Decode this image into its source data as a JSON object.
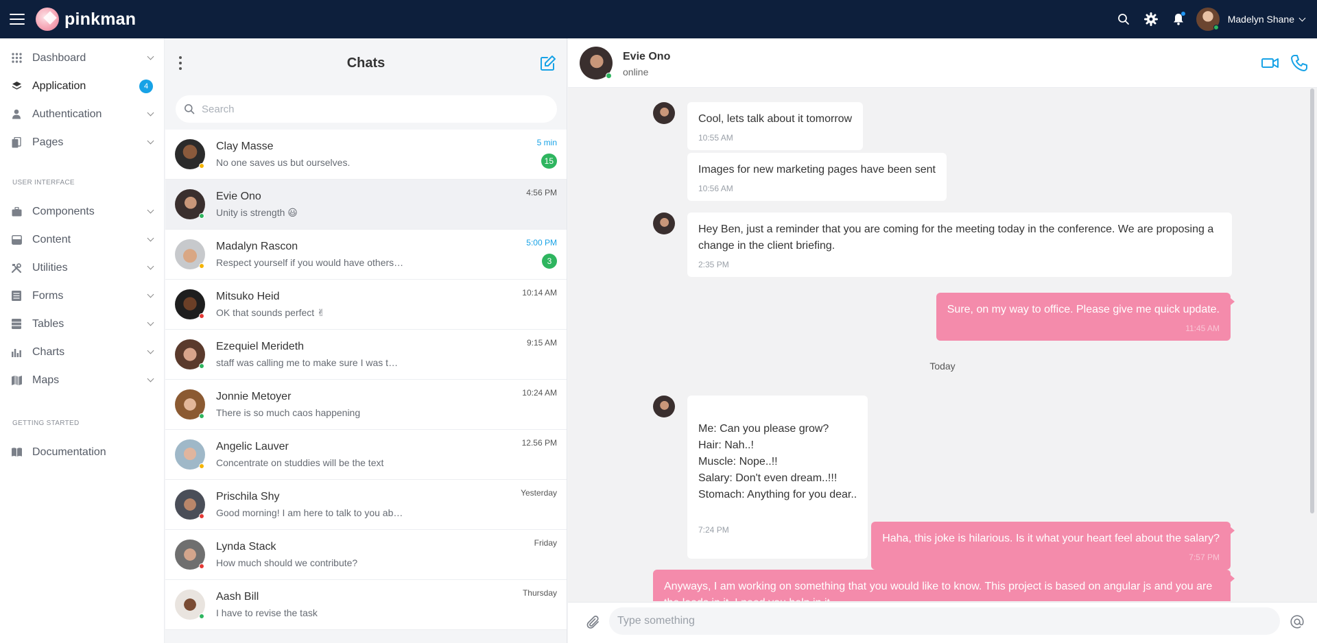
{
  "app": {
    "name": "pinkman",
    "user_name": "Madelyn Shane"
  },
  "sidebar": {
    "items": [
      {
        "label": "Dashboard"
      },
      {
        "label": "Application",
        "badge": "4"
      },
      {
        "label": "Authentication"
      },
      {
        "label": "Pages"
      }
    ],
    "section_ui": "USER INTERFACE",
    "ui_items": [
      {
        "label": "Components"
      },
      {
        "label": "Content"
      },
      {
        "label": "Utilities"
      },
      {
        "label": "Forms"
      },
      {
        "label": "Tables"
      },
      {
        "label": "Charts"
      },
      {
        "label": "Maps"
      }
    ],
    "section_start": "GETTING STARTED",
    "start_items": [
      {
        "label": "Documentation"
      }
    ]
  },
  "chatlist": {
    "title": "Chats",
    "search_placeholder": "Search",
    "conversations": [
      {
        "name": "Clay Masse",
        "message": "No one saves us but ourselves.",
        "time": "5 min",
        "unread": "15"
      },
      {
        "name": "Evie Ono",
        "message": "Unity is strength 😃",
        "time": "4:56 PM"
      },
      {
        "name": "Madalyn Rascon",
        "message": "Respect yourself if you would have others…",
        "time": "5:00 PM",
        "unread": "3"
      },
      {
        "name": "Mitsuko Heid",
        "message": "OK that sounds perfect ✌",
        "time": "10:14 AM"
      },
      {
        "name": "Ezequiel Merideth",
        "message": "staff was calling me to make sure I was t…",
        "time": "9:15 AM"
      },
      {
        "name": "Jonnie Metoyer",
        "message": "There is so much caos happening",
        "time": "10:24 AM"
      },
      {
        "name": "Angelic Lauver",
        "message": "Concentrate on studdies will be the text",
        "time": "12.56 PM"
      },
      {
        "name": "Prischila Shy",
        "message": "Good morning! I am here to talk to you ab…",
        "time": "Yesterday"
      },
      {
        "name": "Lynda Stack",
        "message": "How much should we contribute?",
        "time": "Friday"
      },
      {
        "name": "Aash Bill",
        "message": "I have to revise the task",
        "time": "Thursday"
      }
    ]
  },
  "chat": {
    "contact_name": "Evie Ono",
    "contact_status": "online",
    "messages": [
      {
        "text": "Cool, lets talk about it tomorrow",
        "time": "10:55 AM"
      },
      {
        "text": "Images for new marketing pages have been sent",
        "time": "10:56 AM"
      },
      {
        "text": "Hey Ben, just a reminder that you are coming for the meeting today in the conference. We are proposing a change in the client briefing.",
        "time": "2:35 PM"
      },
      {
        "text": "Sure, on my way to office. Please give me quick update.",
        "time": "11:45 AM"
      },
      {
        "text": "Me: Can you please grow?\nHair: Nah..!\nMuscle: Nope..!!\nSalary: Don't even dream..!!!\nStomach: Anything for you dear..",
        "time": "7:24 PM"
      },
      {
        "text": "Haha, this joke is hilarious. Is it what your heart feel about the salary?",
        "time": "7:57 PM"
      },
      {
        "text": "Anyways, I am working on something that you would like to know. This project is based on angular js and you are the leads in it. I need you help in it"
      }
    ],
    "day_separator": "Today",
    "input_placeholder": "Type something"
  },
  "colors": {
    "topbar": "#0d1f3c",
    "accent": "#17a2e6",
    "outgoing_bubble": "#f48bab",
    "unread_badge": "#2eb55f"
  }
}
